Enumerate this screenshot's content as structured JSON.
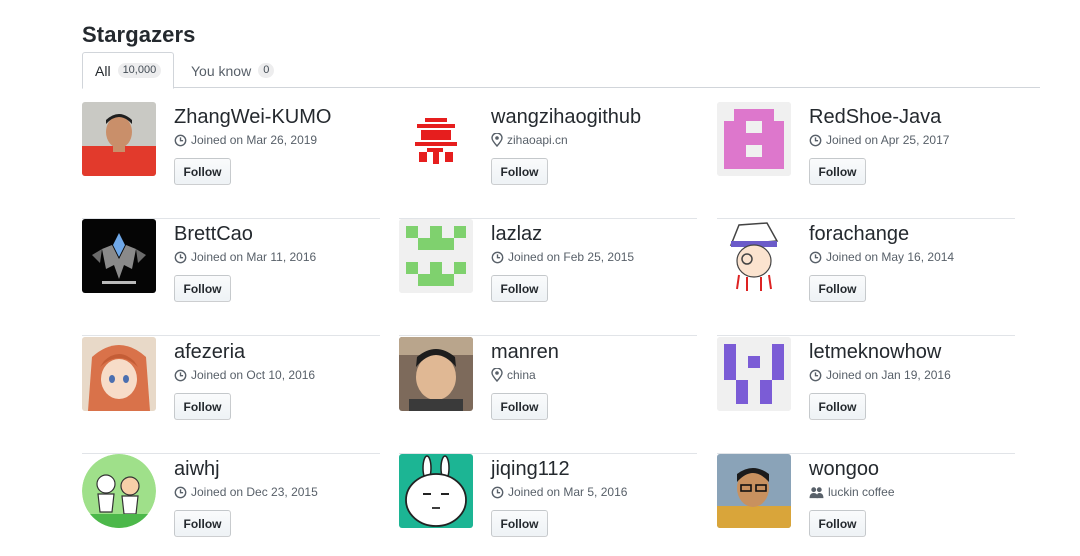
{
  "header": {
    "title": "Stargazers"
  },
  "tabs": [
    {
      "label": "All",
      "count": "10,000"
    },
    {
      "label": "You know",
      "count": "0"
    }
  ],
  "users": [
    {
      "name": "ZhangWei-KUMO",
      "meta_icon": "clock-icon",
      "meta": "Joined on Mar 26, 2019",
      "follow": "Follow"
    },
    {
      "name": "wangzihaogithub",
      "meta_icon": "location-icon",
      "meta": "zihaoapi.cn",
      "follow": "Follow"
    },
    {
      "name": "RedShoe-Java",
      "meta_icon": "clock-icon",
      "meta": "Joined on Apr 25, 2017",
      "follow": "Follow"
    },
    {
      "name": "BrettCao",
      "meta_icon": "clock-icon",
      "meta": "Joined on Mar 11, 2016",
      "follow": "Follow"
    },
    {
      "name": "lazlaz",
      "meta_icon": "clock-icon",
      "meta": "Joined on Feb 25, 2015",
      "follow": "Follow"
    },
    {
      "name": "forachange",
      "meta_icon": "clock-icon",
      "meta": "Joined on May 16, 2014",
      "follow": "Follow"
    },
    {
      "name": "afezeria",
      "meta_icon": "clock-icon",
      "meta": "Joined on Oct 10, 2016",
      "follow": "Follow"
    },
    {
      "name": "manren",
      "meta_icon": "location-icon",
      "meta": "china",
      "follow": "Follow"
    },
    {
      "name": "letmeknowhow",
      "meta_icon": "clock-icon",
      "meta": "Joined on Jan 19, 2016",
      "follow": "Follow"
    },
    {
      "name": "aiwhj",
      "meta_icon": "clock-icon",
      "meta": "Joined on Dec 23, 2015",
      "follow": "Follow"
    },
    {
      "name": "jiqing112",
      "meta_icon": "clock-icon",
      "meta": "Joined on Mar 5, 2016",
      "follow": "Follow"
    },
    {
      "name": "wongoo",
      "meta_icon": "people-icon",
      "meta": "luckin coffee",
      "follow": "Follow"
    }
  ],
  "colors": {
    "text": "#24292e",
    "muted": "#586069",
    "border": "#e1e4e8",
    "identicon_red_blocks": "#e61e1e",
    "identicon_pink": "#dd77cc",
    "identicon_green": "#7fd16e",
    "identicon_purple": "#7b5cd6"
  }
}
